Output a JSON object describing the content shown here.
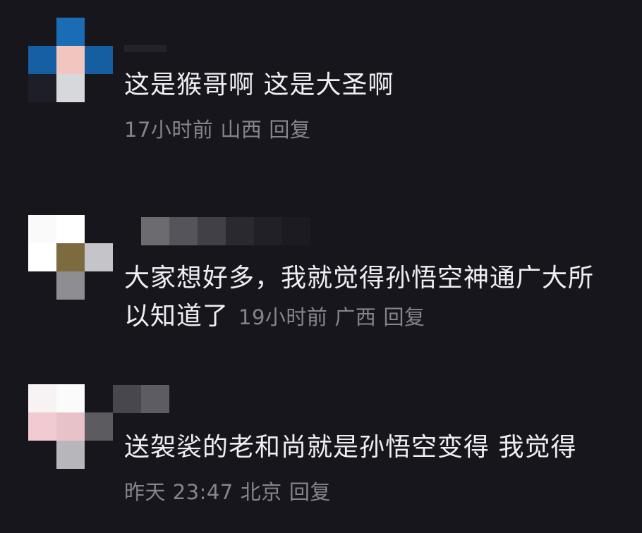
{
  "comments": [
    {
      "text": "这是猴哥啊 这是大圣啊",
      "time": "17小时前",
      "location": "山西",
      "reply": "回复"
    },
    {
      "text": "大家想好多，我就觉得孙悟空神通广大所以知道了",
      "time": "19小时前",
      "location": "广西",
      "reply": "回复"
    },
    {
      "text": "送袈裟的老和尚就是孙悟空变得 我觉得",
      "time": "昨天 23:47",
      "location": "北京",
      "reply": "回复"
    }
  ]
}
